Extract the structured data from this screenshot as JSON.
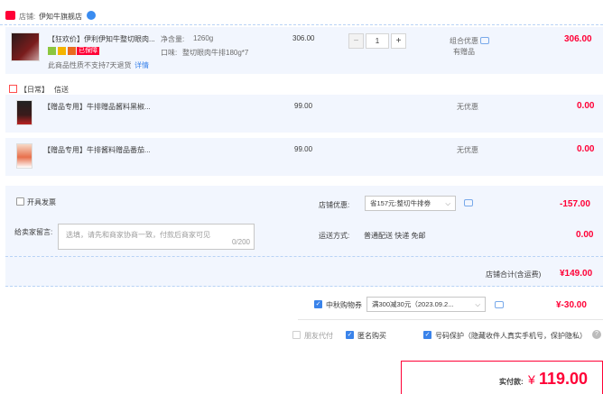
{
  "shop": {
    "label": "店铺:",
    "name": "伊知牛旗舰店"
  },
  "main_item": {
    "title": "【狂欢价】伊利伊知牛整切眼肉...",
    "badge_tag": "已保障",
    "net_label": "净含量:",
    "net_value": "1260g",
    "flavor_label": "口味:",
    "flavor_value": "整切眼肉牛排180g*7",
    "return_note": "此商品性质不支持7天退货",
    "return_link": "详情",
    "unit_price": "306.00",
    "quantity": "1",
    "minus": "−",
    "plus": "+",
    "promo_type": "组合优惠",
    "promo_sub": "有赠品",
    "subtotal": "306.00"
  },
  "gift_section": {
    "tag": "【日常】",
    "label": "信送"
  },
  "gifts": [
    {
      "title": "【赠品专用】牛排赠品酱料黑椒...",
      "price": "99.00",
      "promo": "无优惠",
      "subtotal": "0.00"
    },
    {
      "title": "【赠品专用】牛排酱料赠品番茄...",
      "price": "99.00",
      "promo": "无优惠",
      "subtotal": "0.00"
    }
  ],
  "options": {
    "invoice_label": "开具发票",
    "shop_discount_label": "店铺优惠:",
    "shop_discount_value": "省157元:整切牛排劵",
    "shop_discount_amount": "-157.00",
    "message_label": "给卖家留言:",
    "message_placeholder": "选填，请先和商家协商一致，付款后商家可见",
    "message_count": "0/200",
    "shipping_label": "运送方式:",
    "shipping_value": "普通配送 快递 免邮",
    "shipping_amount": "0.00"
  },
  "shop_total": {
    "label": "店铺合计(含运费)",
    "value": "¥149.00"
  },
  "coupon": {
    "label": "中秋购物券",
    "value": "满300减30元（2023.09.2...",
    "amount": "¥-30.00"
  },
  "footer_checks": {
    "friend_pay": "朋友代付",
    "anonymous": "匿名购买",
    "privacy": "号码保护（隐藏收件人真实手机号，保护隐私）"
  },
  "payment": {
    "label": "实付款:",
    "currency": "¥",
    "amount": "119.00"
  },
  "colors": {
    "accent_red": "#ff0036",
    "link_blue": "#3a83ea",
    "panel_bg": "#f2f6fe"
  }
}
